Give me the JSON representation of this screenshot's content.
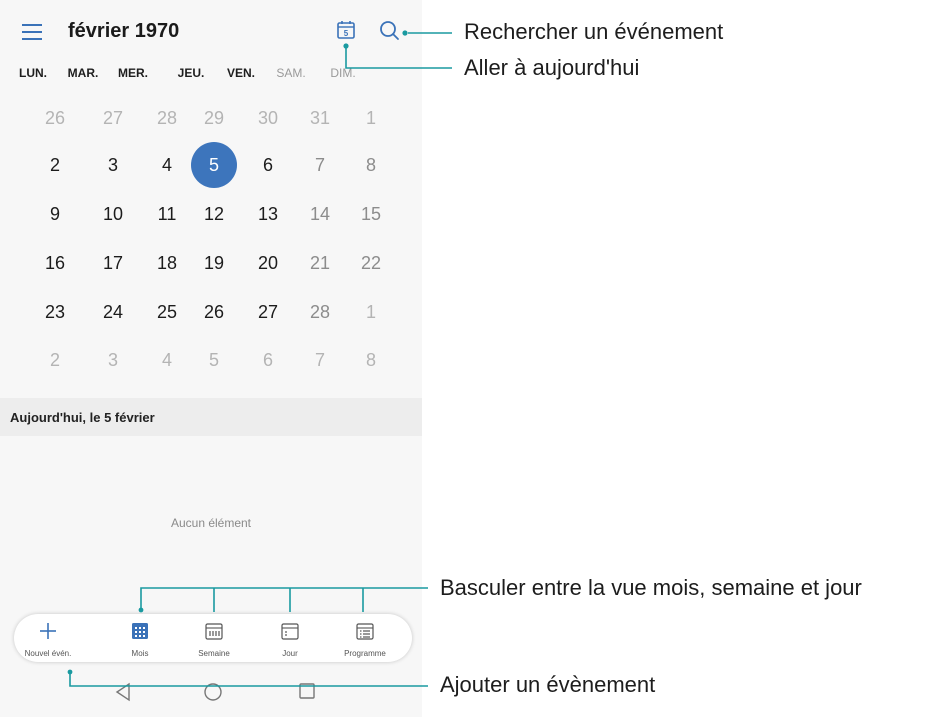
{
  "header": {
    "title": "février 1970",
    "today_icon_number": "5"
  },
  "weekdays": [
    {
      "label": "LUN.",
      "weekend": false
    },
    {
      "label": "MAR.",
      "weekend": false
    },
    {
      "label": "MER.",
      "weekend": false
    },
    {
      "label": "JEU.",
      "weekend": false
    },
    {
      "label": "VEN.",
      "weekend": false
    },
    {
      "label": "SAM.",
      "weekend": true
    },
    {
      "label": "DIM.",
      "weekend": true
    }
  ],
  "weeks": [
    [
      "26",
      "27",
      "28",
      "29",
      "30",
      "31",
      "1"
    ],
    [
      "2",
      "3",
      "4",
      "5",
      "6",
      "7",
      "8"
    ],
    [
      "9",
      "10",
      "11",
      "12",
      "13",
      "14",
      "15"
    ],
    [
      "16",
      "17",
      "18",
      "19",
      "20",
      "21",
      "22"
    ],
    [
      "23",
      "24",
      "25",
      "26",
      "27",
      "28",
      "1"
    ],
    [
      "2",
      "3",
      "4",
      "5",
      "6",
      "7",
      "8"
    ]
  ],
  "current_month_range": {
    "first_week": 1,
    "first_day_col": 0,
    "last_week": 4,
    "last_day_col": 5
  },
  "selected_day": "5",
  "today_section": {
    "title": "Aujourd'hui, le  5 février",
    "empty_message": "Aucun élément"
  },
  "bottom_bar": {
    "items": [
      {
        "label": "Nouvel évén.",
        "icon": "plus-icon"
      },
      {
        "label": "Mois",
        "icon": "month-view-icon"
      },
      {
        "label": "Semaine",
        "icon": "week-view-icon"
      },
      {
        "label": "Jour",
        "icon": "day-view-icon"
      },
      {
        "label": "Programme",
        "icon": "agenda-view-icon"
      }
    ]
  },
  "system_nav": [
    "back-icon",
    "home-icon",
    "recents-icon"
  ],
  "callouts": {
    "search": "Rechercher un événement",
    "today": "Aller à aujourd'hui",
    "switch_view": "Basculer entre la vue mois, semaine et jour",
    "add_event": "Ajouter un évènement"
  },
  "colors": {
    "accent": "#3d75bc",
    "leader_line": "#1a9aa0",
    "muted_text": "#b4b4b4"
  }
}
